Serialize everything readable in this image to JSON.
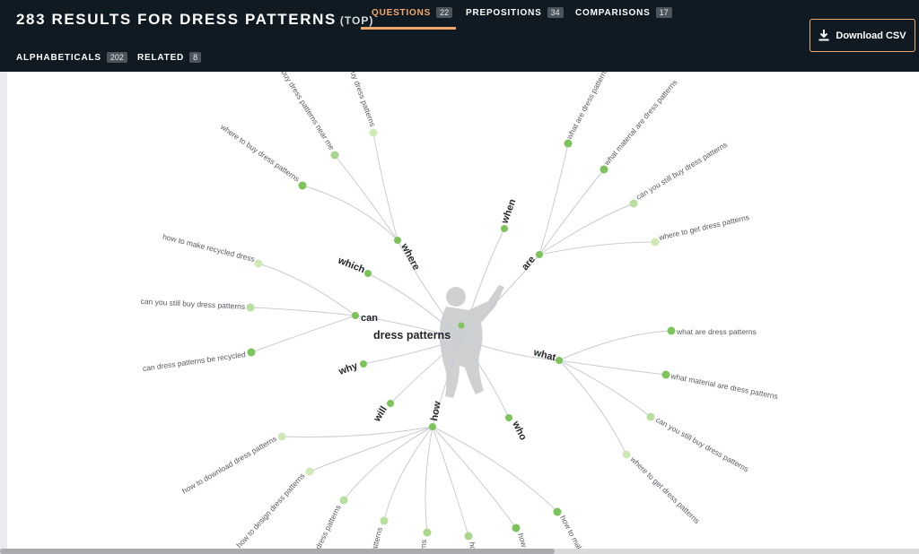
{
  "header": {
    "title": "283 RESULTS FOR DRESS PATTERNS",
    "title_suffix": "(TOP)",
    "download_label": "Download CSV"
  },
  "tabs": [
    {
      "label": "QUESTIONS",
      "count": "22",
      "active": true
    },
    {
      "label": "PREPOSITIONS",
      "count": "34",
      "active": false
    },
    {
      "label": "COMPARISONS",
      "count": "17",
      "active": false
    },
    {
      "label": "ALPHABETICALS",
      "count": "202",
      "active": false
    },
    {
      "label": "RELATED",
      "count": "8",
      "active": false
    }
  ],
  "wheel": {
    "center": "dress patterns",
    "modifiers": [
      "where",
      "which",
      "can",
      "why",
      "will",
      "how",
      "who",
      "what",
      "are",
      "when"
    ],
    "branches": {
      "where": [
        "where to buy dress patterns",
        "buy dress patterns near me",
        "buy dress patterns"
      ],
      "can": [
        "how to make recycled dress",
        "can you still buy dress patterns",
        "can dress patterns be recycled"
      ],
      "are": [
        "what are dress patterns",
        "what material are dress patterns",
        "can you still buy dress patterns",
        "where to get dress patterns"
      ],
      "what": [
        "what are dress patterns",
        "what material are dress patterns",
        "can you still buy dress patterns",
        "where to get dress patterns"
      ],
      "how": [
        "how to download dress patterns",
        "how to design dress patterns",
        "dress patterns",
        "patterns",
        "patterns",
        "how",
        "how",
        "how to make"
      ]
    }
  },
  "colors": {
    "header_bg": "#0f1a22",
    "accent": "#f2a96b",
    "node_dark": "#7dc35b",
    "node_light": "#cfe9b6",
    "link": "#c7ccd2"
  },
  "icons": {
    "download": "download-icon",
    "silhouette": "person-silhouette"
  }
}
